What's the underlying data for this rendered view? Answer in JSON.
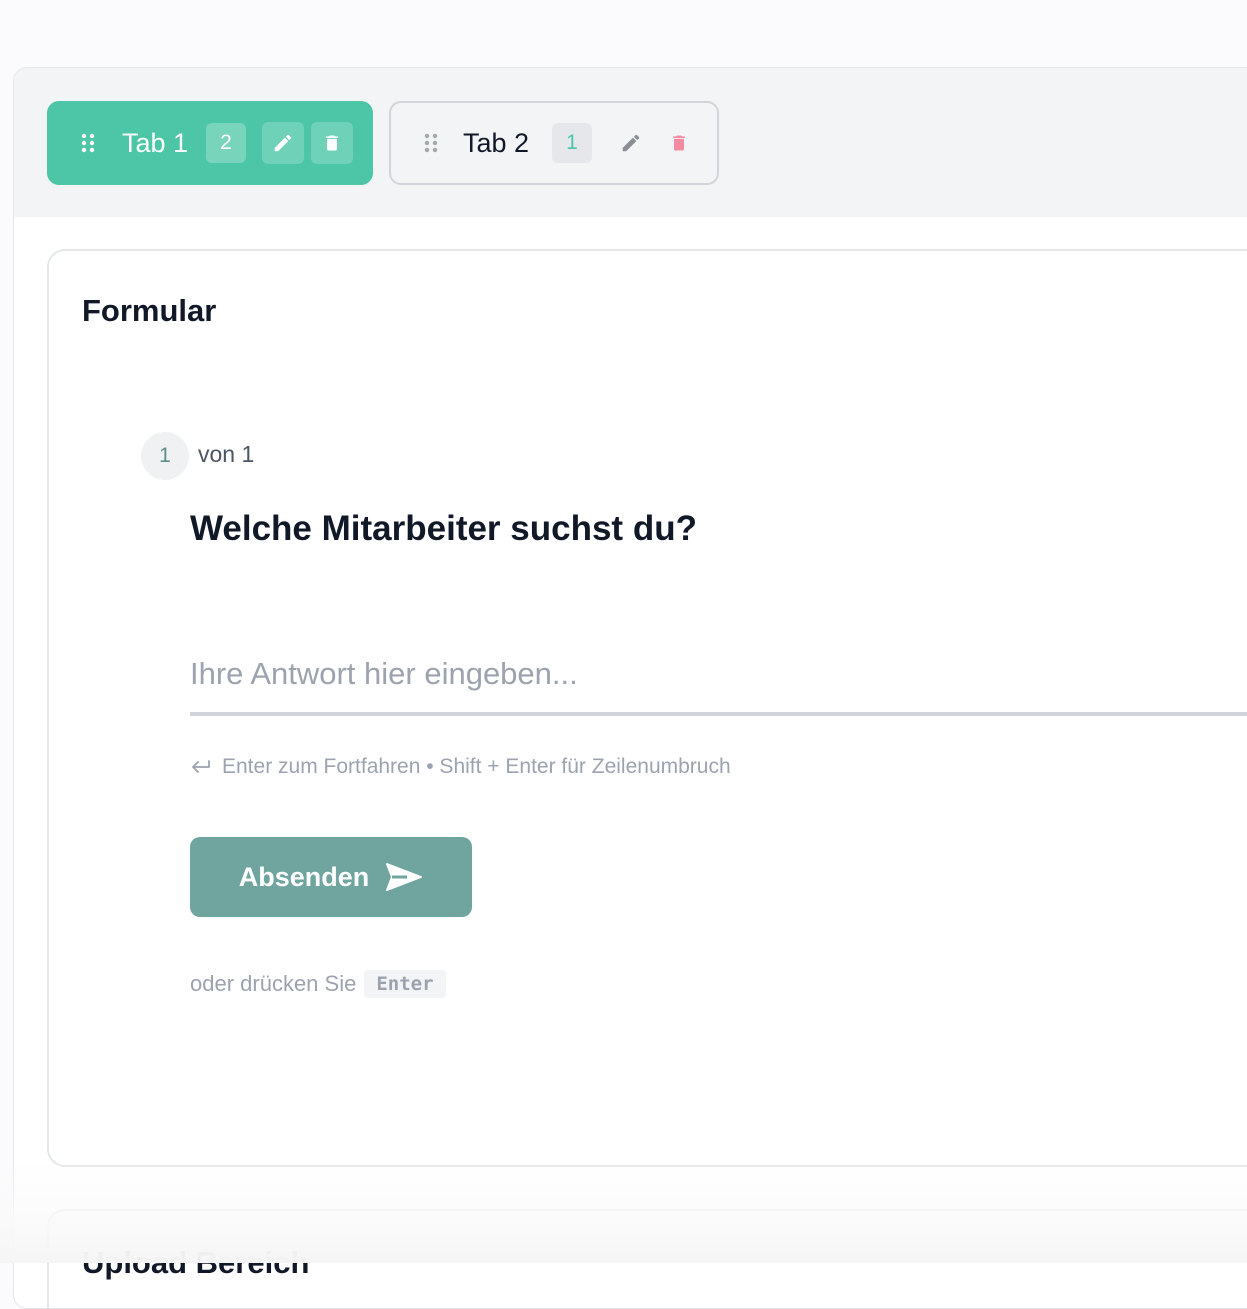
{
  "tabs": [
    {
      "label": "Tab 1",
      "count": "2",
      "active": true
    },
    {
      "label": "Tab 2",
      "count": "1",
      "active": false
    }
  ],
  "form": {
    "title": "Formular",
    "step_current": "1",
    "step_of": "von 1",
    "question": "Welche Mitarbeiter suchst du?",
    "answer_placeholder": "Ihre Antwort hier eingeben...",
    "answer_value": "",
    "hint": "Enter zum Fortfahren • Shift + Enter für Zeilenumbruch",
    "submit_label": "Absenden",
    "alt_hint": "oder drücken Sie",
    "alt_key": "Enter"
  },
  "next_section": {
    "title": "Upload Bereich"
  },
  "colors": {
    "accent": "#4cc6a6",
    "button": "#6fa59e",
    "delete": "#f58ba1",
    "text": "#111827",
    "muted": "#9ca3af"
  },
  "icons": {
    "drag": "drag-handle-icon",
    "edit": "pencil-icon",
    "delete": "trash-icon",
    "enter": "enter-arrow-icon",
    "send": "send-icon"
  }
}
